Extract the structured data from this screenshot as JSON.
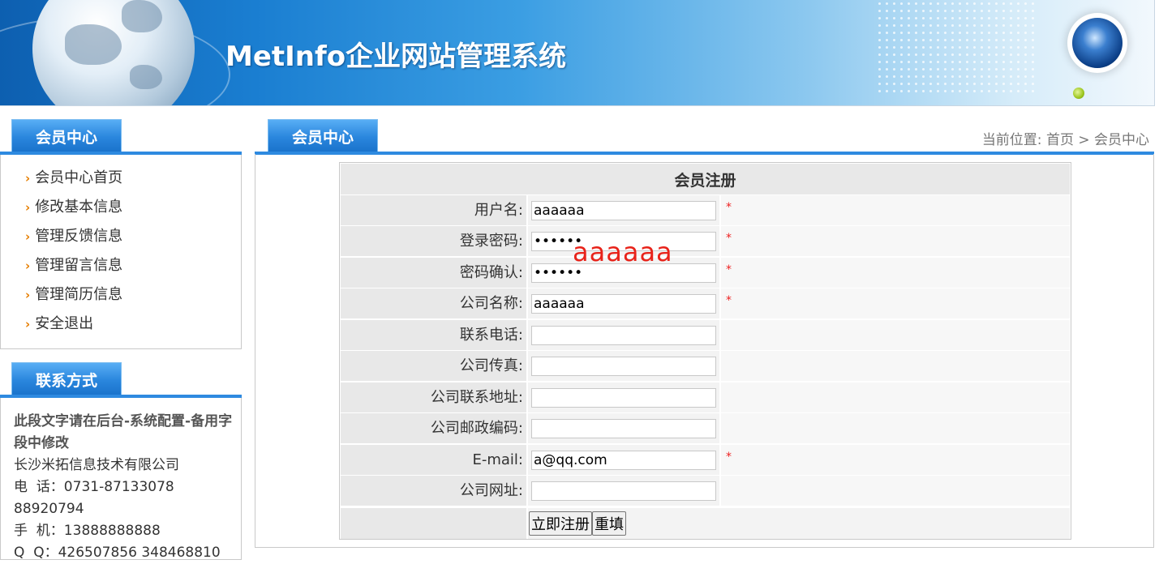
{
  "banner": {
    "title": "MetInfo企业网站管理系统"
  },
  "sidebar": {
    "member_title": "会员中心",
    "items": [
      {
        "label": "会员中心首页"
      },
      {
        "label": "修改基本信息"
      },
      {
        "label": "管理反馈信息"
      },
      {
        "label": "管理留言信息"
      },
      {
        "label": "管理简历信息"
      },
      {
        "label": "安全退出"
      }
    ],
    "contact_title": "联系方式",
    "contact_note": "此段文字请在后台-系统配置-备用字段中修改",
    "contact_lines": [
      "长沙米拓信息技术有限公司",
      "电  话：0731-87133078",
      "88920794",
      "手  机：13888888888",
      "Q  Q：426507856 348468810"
    ]
  },
  "main": {
    "tab_title": "会员中心",
    "breadcrumb": "当前位置: 首页 > 会员中心",
    "form_title": "会员注册",
    "fields": [
      {
        "label": "用户名:",
        "value": "aaaaaa",
        "type": "text",
        "required": true
      },
      {
        "label": "登录密码:",
        "value": "aaaaaa",
        "type": "password",
        "required": true
      },
      {
        "label": "密码确认:",
        "value": "aaaaaa",
        "type": "password",
        "required": true
      },
      {
        "label": "公司名称:",
        "value": "aaaaaa",
        "type": "text",
        "required": true
      },
      {
        "label": "联系电话:",
        "value": "",
        "type": "text",
        "required": false
      },
      {
        "label": "公司传真:",
        "value": "",
        "type": "text",
        "required": false
      },
      {
        "label": "公司联系地址:",
        "value": "",
        "type": "text",
        "required": false
      },
      {
        "label": "公司邮政编码:",
        "value": "",
        "type": "text",
        "required": false
      },
      {
        "label": "E-mail:",
        "value": "a@qq.com",
        "type": "text",
        "required": true
      },
      {
        "label": "公司网址:",
        "value": "",
        "type": "text",
        "required": false
      }
    ],
    "required_mark": "*",
    "submit_label": "立即注册",
    "reset_label": "重填",
    "overlay_note": "aaaaaa"
  },
  "colors": {
    "accent": "#2e8ae0",
    "required": "#e22222",
    "menu_arrow": "#e67e00",
    "overlay": "#e8231a"
  }
}
